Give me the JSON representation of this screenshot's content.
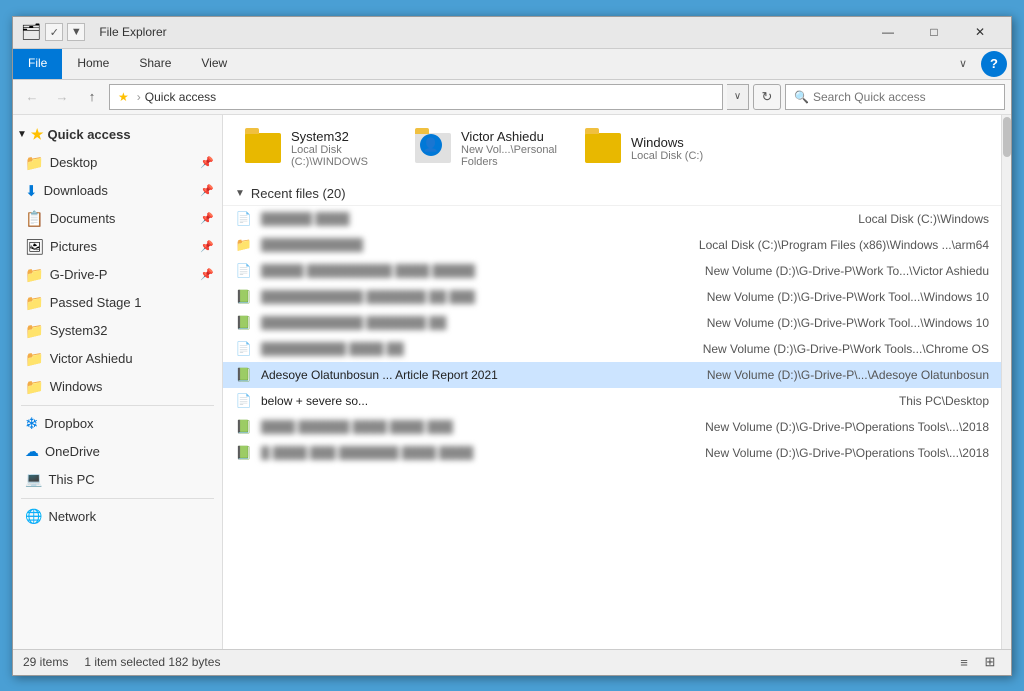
{
  "window": {
    "title": "File Explorer",
    "titlebar_icon1": "🗂",
    "titlebar_icon2": "✓",
    "minimize": "—",
    "maximize": "□",
    "close": "✕"
  },
  "ribbon": {
    "tabs": [
      "File",
      "Home",
      "Share",
      "View"
    ],
    "active_tab": "File",
    "chevron": "∨",
    "help": "?"
  },
  "addressbar": {
    "back": "←",
    "forward": "→",
    "up": "↑",
    "star": "★",
    "separator": "›",
    "path": "Quick access",
    "dropdown": "∨",
    "refresh": "↻",
    "search_placeholder": "Search Quick access",
    "search_icon": "🔍"
  },
  "sidebar": {
    "quick_access_label": "Quick access",
    "items": [
      {
        "label": "Desktop",
        "icon": "folder-blue",
        "pinned": true
      },
      {
        "label": "Downloads",
        "icon": "folder-blue",
        "pinned": true
      },
      {
        "label": "Documents",
        "icon": "folder-doc",
        "pinned": true
      },
      {
        "label": "Pictures",
        "icon": "folder-img",
        "pinned": true
      },
      {
        "label": "G-Drive-P",
        "icon": "folder-yellow",
        "pinned": true
      },
      {
        "label": "Passed Stage 1",
        "icon": "folder-yellow",
        "pinned": false
      },
      {
        "label": "System32",
        "icon": "folder-yellow",
        "pinned": false
      },
      {
        "label": "Victor Ashiedu",
        "icon": "folder-yellow",
        "pinned": false
      },
      {
        "label": "Windows",
        "icon": "folder-yellow",
        "pinned": false
      }
    ],
    "other": [
      {
        "label": "Dropbox",
        "icon": "dropbox"
      },
      {
        "label": "OneDrive",
        "icon": "onedrive"
      },
      {
        "label": "This PC",
        "icon": "computer"
      },
      {
        "label": "Network",
        "icon": "network"
      }
    ]
  },
  "pinned_folders": [
    {
      "name": "System32",
      "path": "Local Disk (C:)\\WINDOWS",
      "type": "folder"
    },
    {
      "name": "Victor Ashiedu",
      "path": "New Vol...\\Personal Folders",
      "type": "user"
    },
    {
      "name": "Windows",
      "path": "Local Disk (C:)",
      "type": "folder"
    }
  ],
  "recent_section": {
    "label": "Recent files (20)",
    "chevron": "∨"
  },
  "files": [
    {
      "name": "blurred-name-1",
      "path": "Local Disk (C:)\\Windows",
      "icon": "📄",
      "blurred": true,
      "selected": false
    },
    {
      "name": "blurred-name-2",
      "path": "Local Disk (C:)\\Program Files (x86)\\Windows ...\\arm64",
      "icon": "📁",
      "blurred": true,
      "selected": false
    },
    {
      "name": "blurred-name-3",
      "path": "New Volume (D:)\\G-Drive-P\\Work To...\\Victor Ashiedu",
      "icon": "📄",
      "blurred": true,
      "selected": false
    },
    {
      "name": "blurred-name-4",
      "path": "New Volume (D:)\\G-Drive-P\\Work Tool...\\Windows 10",
      "icon": "📗",
      "blurred": true,
      "selected": false
    },
    {
      "name": "blurred-name-5",
      "path": "New Volume (D:)\\G-Drive-P\\Work Tool...\\Windows 10",
      "icon": "📗",
      "blurred": true,
      "selected": false
    },
    {
      "name": "blurred-name-6",
      "path": "New Volume (D:)\\G-Drive-P\\Work Tools...\\Chrome OS",
      "icon": "📄",
      "blurred": true,
      "selected": false
    },
    {
      "name": "Adesoye Olatunbosun ... Article Report 2021",
      "path": "New Volume (D:)\\G-Drive-P\\...\\Adesoye Olatunbosun",
      "icon": "📗",
      "blurred": false,
      "selected": true
    },
    {
      "name": "below + severe so...",
      "path": "This PC\\Desktop",
      "icon": "📄",
      "blurred": false,
      "selected": false
    },
    {
      "name": "blurred-name-9",
      "path": "New Volume (D:)\\G-Drive-P\\Operations Tools\\...\\2018",
      "icon": "📗",
      "blurred": true,
      "selected": false
    },
    {
      "name": "blurred-name-10",
      "path": "New Volume (D:)\\G-Drive-P\\Operations Tools\\...\\2018",
      "icon": "📗",
      "blurred": true,
      "selected": false
    }
  ],
  "statusbar": {
    "item_count": "29 items",
    "selected": "1 item selected  182 bytes",
    "view_list": "≡",
    "view_detail": "⊞"
  }
}
